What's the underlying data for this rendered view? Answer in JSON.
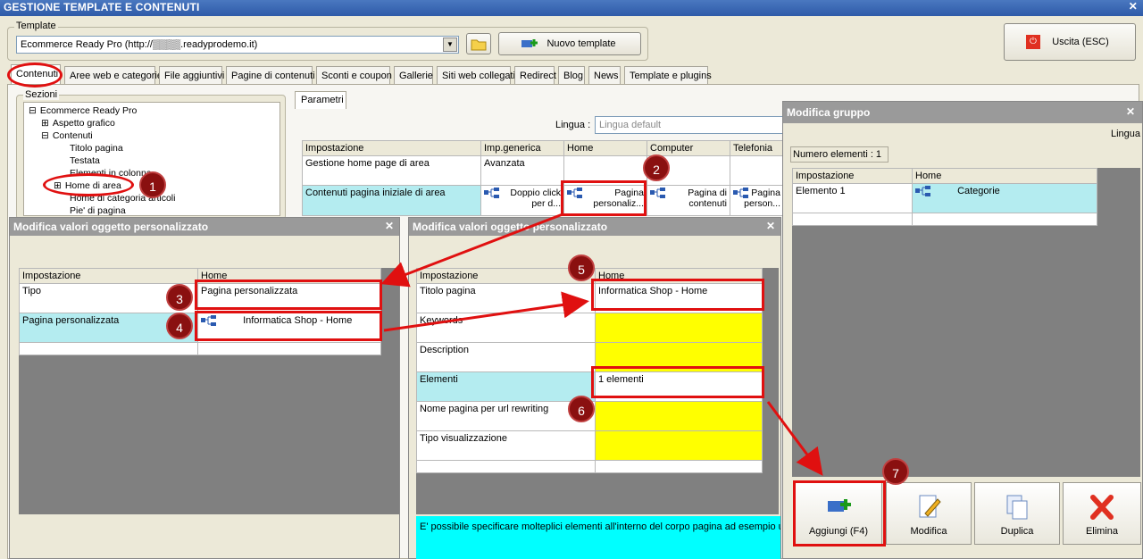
{
  "window": {
    "title": "GESTIONE TEMPLATE E CONTENUTI",
    "close": "✕"
  },
  "template": {
    "label": "Template",
    "combo_value": "Ecommerce Ready Pro (http://▒▒▒▒.readyprodemo.it)",
    "new_button": "Nuovo template"
  },
  "exit_button": "Uscita (ESC)",
  "tabs": [
    "Contenuti",
    "Aree web e categorie",
    "File aggiuntivi",
    "Pagine di contenuti",
    "Sconti e coupon",
    "Gallerie",
    "Siti web collegati",
    "Redirect",
    "Blog",
    "News",
    "Template e plugins"
  ],
  "sections": {
    "label": "Sezioni",
    "tree": [
      {
        "text": "Ecommerce Ready Pro",
        "sign": "⊟"
      },
      {
        "text": "Aspetto grafico",
        "sign": "⊞"
      },
      {
        "text": "Contenuti",
        "sign": "⊟"
      },
      {
        "text": "Titolo pagina",
        "sign": ""
      },
      {
        "text": "Testata",
        "sign": ""
      },
      {
        "text": "Elementi in colonna",
        "sign": ""
      },
      {
        "text": "Home di area",
        "sign": "⊞"
      },
      {
        "text": "Home di categoria articoli",
        "sign": ""
      },
      {
        "text": "Pie' di pagina",
        "sign": ""
      }
    ]
  },
  "params": {
    "tab": "Parametri",
    "lingua_label": "Lingua :",
    "lingua_value": "Lingua default",
    "headers": [
      "Impostazione",
      "Imp.generica",
      "Home",
      "Computer",
      "Telefonia"
    ],
    "row1": {
      "label": "Gestione home page di area",
      "generic": "Avanzata"
    },
    "row2": {
      "label": "Contenuti pagina iniziale di area",
      "generic": "Doppio click per d...",
      "home": "Pagina personaliz...",
      "computer": "Pagina di contenuti",
      "telefonia": "Pagina person..."
    }
  },
  "dialog1": {
    "title": "Modifica valori oggetto personalizzato",
    "headers": [
      "Impostazione",
      "Home"
    ],
    "rows": [
      {
        "label": "Tipo",
        "value": "Pagina personalizzata"
      },
      {
        "label": "Pagina personalizzata",
        "value": "Informatica Shop - Home"
      }
    ]
  },
  "dialog2": {
    "title": "Modifica valori oggetto personalizzato",
    "headers": [
      "Impostazione",
      "Home"
    ],
    "rows": [
      {
        "label": "Titolo pagina",
        "value": "Informatica Shop - Home"
      },
      {
        "label": "Keywords",
        "value": ""
      },
      {
        "label": "Description",
        "value": ""
      },
      {
        "label": "Elementi",
        "value": "1 elementi"
      },
      {
        "label": "Nome pagina per url rewriting",
        "value": ""
      },
      {
        "label": "Tipo visualizzazione",
        "value": ""
      }
    ],
    "note": "E' possibile specificare molteplici elementi all'interno del corpo pagina ad esempio un te"
  },
  "dialog3": {
    "title": "Modifica gruppo",
    "lingua": "Lingua",
    "count": "Numero elementi : 1",
    "headers": [
      "Impostazione",
      "Home"
    ],
    "rows": [
      {
        "label": "Elemento 1",
        "value": "Categorie"
      }
    ],
    "buttons": [
      "Aggiungi (F4)",
      "Modifica",
      "Duplica",
      "Elimina"
    ]
  },
  "badges": [
    "1",
    "2",
    "3",
    "4",
    "5",
    "6",
    "7"
  ],
  "colors": {
    "highlight_red": "#e01010",
    "cyan": "#b4ecf0",
    "yellow": "#ffff00"
  }
}
